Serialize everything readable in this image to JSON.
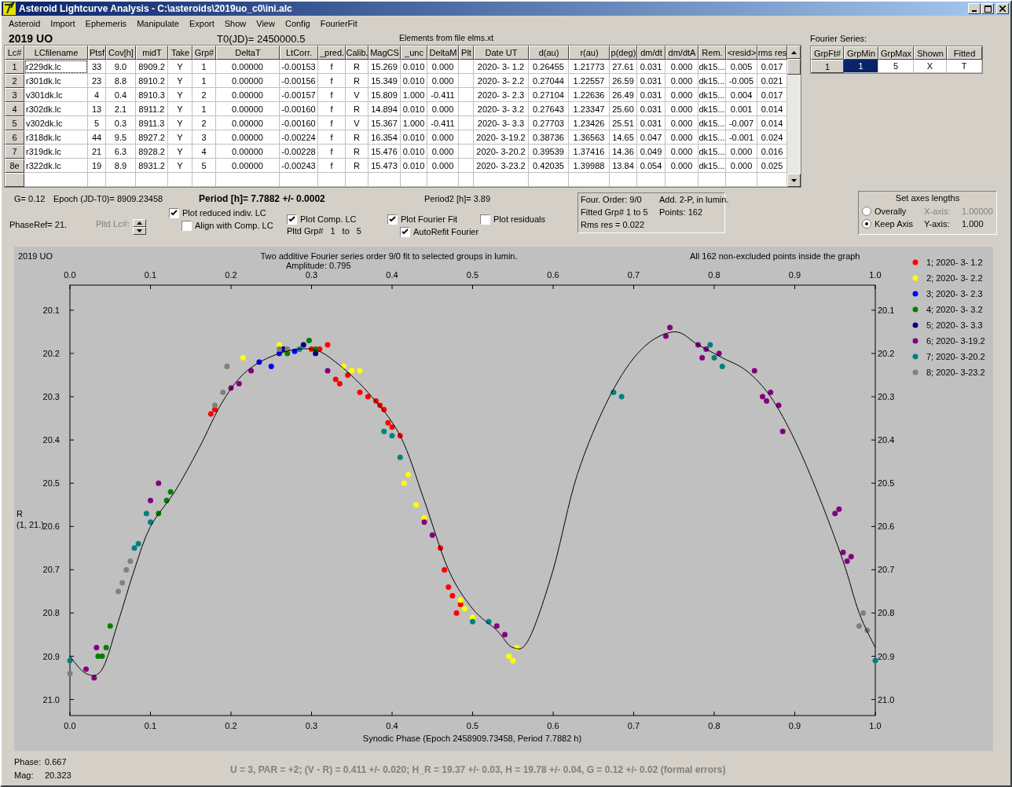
{
  "window": {
    "title": "Asteroid Lightcurve Analysis - C:\\asteroids\\2019uo_c0\\ini.alc"
  },
  "menu": [
    "Asteroid",
    "Import",
    "Ephemeris",
    "Manipulate",
    "Export",
    "Show",
    "View",
    "Config",
    "FourierFit"
  ],
  "header": {
    "object": "2019 UO",
    "t0": "T0(JD)= 2450000.5",
    "elements": "Elements from file elms.xt"
  },
  "lc_table": {
    "columns": [
      "Lc#",
      "LCfilename",
      "Ptsf",
      "Cov[h]",
      "midT",
      "Take",
      "Grp#",
      "DeltaT",
      "LtCorr.",
      "_pred.",
      "Calib.",
      "MagCS",
      "_unc",
      "DeltaM",
      "Plt",
      "Date UT",
      "d(au)",
      "r(au)",
      "p(deg)",
      "dm/dt",
      "dm/dtA",
      "Rem.",
      "<resid>",
      "rms res"
    ],
    "rows": [
      [
        "1",
        "r229dk.lc",
        "33",
        "9.0",
        "8909.2",
        "Y",
        "1",
        "0.00000",
        "-0.00153",
        "f",
        "R",
        "15.269",
        "0.010",
        "0.000",
        null,
        "2020- 3- 1.2",
        "0.26455",
        "1.21773",
        "27.61",
        "0.031",
        "0.000",
        "dk15...",
        "0.005",
        "0.017"
      ],
      [
        "2",
        "r301dk.lc",
        "23",
        "8.8",
        "8910.2",
        "Y",
        "1",
        "0.00000",
        "-0.00156",
        "f",
        "R",
        "15.349",
        "0.010",
        "0.000",
        null,
        "2020- 3- 2.2",
        "0.27044",
        "1.22557",
        "26.59",
        "0.031",
        "0.000",
        "dk15...",
        "-0.005",
        "0.021"
      ],
      [
        "3",
        "v301dk.lc",
        "4",
        "0.4",
        "8910.3",
        "Y",
        "2",
        "0.00000",
        "-0.00157",
        "f",
        "V",
        "15.809",
        "1.000",
        "-0.411",
        null,
        "2020- 3- 2.3",
        "0.27104",
        "1.22636",
        "26.49",
        "0.031",
        "0.000",
        "dk15...",
        "0.004",
        "0.017"
      ],
      [
        "4",
        "r302dk.lc",
        "13",
        "2.1",
        "8911.2",
        "Y",
        "1",
        "0.00000",
        "-0.00160",
        "f",
        "R",
        "14.894",
        "0.010",
        "0.000",
        null,
        "2020- 3- 3.2",
        "0.27643",
        "1.23347",
        "25.60",
        "0.031",
        "0.000",
        "dk15...",
        "0.001",
        "0.014"
      ],
      [
        "5",
        "v302dk.lc",
        "5",
        "0.3",
        "8911.3",
        "Y",
        "2",
        "0.00000",
        "-0.00160",
        "f",
        "V",
        "15.367",
        "1.000",
        "-0.411",
        null,
        "2020- 3- 3.3",
        "0.27703",
        "1.23426",
        "25.51",
        "0.031",
        "0.000",
        "dk15...",
        "-0.007",
        "0.014"
      ],
      [
        "6",
        "r318dk.lc",
        "44",
        "9.5",
        "8927.2",
        "Y",
        "3",
        "0.00000",
        "-0.00224",
        "f",
        "R",
        "16.354",
        "0.010",
        "0.000",
        null,
        "2020- 3-19.2",
        "0.38736",
        "1.36563",
        "14.65",
        "0.047",
        "0.000",
        "dk15...",
        "-0.001",
        "0.024"
      ],
      [
        "7",
        "r319dk.lc",
        "21",
        "6.3",
        "8928.2",
        "Y",
        "4",
        "0.00000",
        "-0.00228",
        "f",
        "R",
        "15.476",
        "0.010",
        "0.000",
        null,
        "2020- 3-20.2",
        "0.39539",
        "1.37416",
        "14.36",
        "0.049",
        "0.000",
        "dk15...",
        "0.000",
        "0.016"
      ],
      [
        "8e",
        "r322dk.lc",
        "19",
        "8.9",
        "8931.2",
        "Y",
        "5",
        "0.00000",
        "-0.00243",
        "f",
        "R",
        "15.473",
        "0.010",
        "0.000",
        null,
        "2020- 3-23.2",
        "0.42035",
        "1.39988",
        "13.84",
        "0.054",
        "0.000",
        "dk15...",
        "0.000",
        "0.025"
      ]
    ]
  },
  "fourier": {
    "label": "Fourier Series:",
    "columns": [
      "GrpFt#",
      "GrpMin",
      "GrpMax",
      "Shown",
      "Fitted"
    ],
    "rows": [
      {
        "cells": [
          {
            "text": "1",
            "selected": false
          },
          {
            "text": "1",
            "selected": true
          },
          {
            "text": "5",
            "selected": false
          },
          {
            "text": "X",
            "selected": false
          },
          {
            "text": "T",
            "selected": false
          }
        ]
      }
    ]
  },
  "info": {
    "g": "G= 0.12",
    "epoch": "Epoch (JD-T0)= 8909.23458",
    "period": "Period [h]= 7.7882 +/- 0.0002",
    "period2": "Period2 [h]= 3.89",
    "phase_ref": "PhaseRef= 21."
  },
  "pltd_lc": {
    "label": "Pltd Lc#:",
    "disabled": true
  },
  "checkboxes": [
    {
      "label": "Plot reduced indiv. LC",
      "checked": true
    },
    {
      "label": "Align with Comp. LC",
      "checked": false
    },
    {
      "label": "Plot Comp. LC",
      "checked": true
    },
    {
      "label": "Plot Fourier Fit",
      "checked": true
    },
    {
      "label": "AutoRefit Fourier",
      "checked": true
    },
    {
      "label": "Plot residuals",
      "checked": false
    }
  ],
  "pltd_grp": {
    "label": "Pltd Grp#",
    "from": "1",
    "to_label": "to",
    "to": "5"
  },
  "fit_summary": [
    "Four. Order:  9/0",
    "Add. 2-P, in lumin.",
    "Fitted Grp# 1 to 5",
    "Points: 162",
    "Rms res     = 0.022"
  ],
  "axes": {
    "title": "Set axes lengths",
    "radios": [
      {
        "label": "Overally",
        "selected": false
      },
      {
        "label": "Keep Axis",
        "selected": true
      }
    ],
    "fields": [
      {
        "label": "X-axis:",
        "value": "1.00000",
        "disabled": true
      },
      {
        "label": "Y-axis:",
        "value": "1.000",
        "disabled": false
      }
    ]
  },
  "chart": {
    "object": "2019 UO",
    "amplitude": "Amplitude: 0.795",
    "note": "All 162 non-excluded points inside the graph",
    "ylabel_sub": "(1, 21.)",
    "chart_data": {
      "type": "scatter",
      "title": "Two additive Fourier series order 9/0 fit to selected groups in lumin.",
      "xlabel": "Synodic Phase (Epoch 2458909.73458, Period 7.7882 h)",
      "ylabel": "R",
      "legend": "right",
      "xlim": [
        0,
        1
      ],
      "ylim": [
        21.037,
        20.042
      ],
      "xticks": [
        {
          "value": 0,
          "label": "0.0"
        },
        {
          "value": 0.1,
          "label": "0.1"
        },
        {
          "value": 0.2,
          "label": "0.2"
        },
        {
          "value": 0.3,
          "label": "0.3"
        },
        {
          "value": 0.4,
          "label": "0.4"
        },
        {
          "value": 0.5,
          "label": "0.5"
        },
        {
          "value": 0.6,
          "label": "0.6"
        },
        {
          "value": 0.7,
          "label": "0.7"
        },
        {
          "value": 0.8,
          "label": "0.8"
        },
        {
          "value": 0.9,
          "label": "0.9"
        },
        {
          "value": 1,
          "label": "1.0"
        }
      ],
      "yticks": [
        {
          "value": 20.1,
          "label": "20.1"
        },
        {
          "value": 20.2,
          "label": "20.2"
        },
        {
          "value": 20.3,
          "label": "20.3"
        },
        {
          "value": 20.4,
          "label": "20.4"
        },
        {
          "value": 20.5,
          "label": "20.5"
        },
        {
          "value": 20.6,
          "label": "20.6"
        },
        {
          "value": 20.7,
          "label": "20.7"
        },
        {
          "value": 20.8,
          "label": "20.8"
        },
        {
          "value": 20.9,
          "label": "20.9"
        },
        {
          "value": 21.0,
          "label": "21.0"
        }
      ],
      "series": [
        {
          "name": "1; 2020- 3- 1.2",
          "color": "#ff0000",
          "x": [
            0.175,
            0.18,
            0.3,
            0.31,
            0.32,
            0.33,
            0.335,
            0.345,
            0.36,
            0.37,
            0.38,
            0.385,
            0.39,
            0.395,
            0.4,
            0.41,
            0.46,
            0.465,
            0.47,
            0.475,
            0.48,
            0.485
          ],
          "values": [
            20.34,
            20.33,
            20.19,
            20.19,
            20.18,
            20.26,
            20.27,
            20.25,
            20.29,
            20.3,
            20.31,
            20.32,
            20.33,
            20.36,
            20.37,
            20.39,
            20.65,
            20.7,
            20.74,
            20.76,
            20.8,
            20.78
          ]
        },
        {
          "name": "2; 2020- 3- 2.2",
          "color": "#ffff00",
          "x": [
            0.215,
            0.26,
            0.34,
            0.35,
            0.36,
            0.415,
            0.42,
            0.43,
            0.44,
            0.485,
            0.49,
            0.5,
            0.545,
            0.55,
            0.555
          ],
          "values": [
            20.21,
            20.18,
            20.23,
            20.24,
            20.24,
            20.5,
            20.48,
            20.55,
            20.58,
            20.77,
            20.79,
            20.81,
            20.9,
            20.91,
            20.88
          ]
        },
        {
          "name": "3; 2020- 3- 2.3",
          "color": "#0000ff",
          "x": [
            0.235,
            0.25,
            0.26,
            0.279
          ],
          "values": [
            20.22,
            20.23,
            20.2,
            20.195
          ]
        },
        {
          "name": "4; 2020- 3- 3.2",
          "color": "#008000",
          "x": [
            0.035,
            0.04,
            0.045,
            0.05,
            0.11,
            0.12,
            0.125,
            0.27,
            0.297,
            0.305
          ],
          "values": [
            20.9,
            20.9,
            20.88,
            20.83,
            20.57,
            20.54,
            20.52,
            20.2,
            20.17,
            20.19
          ]
        },
        {
          "name": "5; 2020- 3- 3.3",
          "color": "#000080",
          "x": [
            0.265,
            0.29,
            0.305
          ],
          "values": [
            20.19,
            20.18,
            20.2
          ]
        },
        {
          "name": "6; 2020- 3-19.2",
          "color": "#800080",
          "x": [
            0.02,
            0.03,
            0.033,
            0.1,
            0.11,
            0.2,
            0.21,
            0.225,
            0.32,
            0.44,
            0.45,
            0.53,
            0.54,
            0.74,
            0.745,
            0.78,
            0.785,
            0.79,
            0.806,
            0.85,
            0.86,
            0.865,
            0.87,
            0.88,
            0.885,
            0.95,
            0.955,
            0.96,
            0.965,
            0.97
          ],
          "values": [
            20.93,
            20.95,
            20.88,
            20.54,
            20.5,
            20.28,
            20.27,
            20.24,
            20.24,
            20.59,
            20.62,
            20.83,
            20.85,
            20.16,
            20.14,
            20.18,
            20.21,
            20.19,
            20.2,
            20.24,
            20.3,
            20.31,
            20.29,
            20.32,
            20.38,
            20.57,
            20.56,
            20.66,
            20.68,
            20.67
          ]
        },
        {
          "name": "7; 2020- 3-20.2",
          "color": "#008080",
          "x": [
            0,
            0.08,
            0.085,
            0.095,
            0.1,
            0.285,
            0.39,
            0.4,
            0.41,
            0.5,
            0.52,
            0.675,
            0.685,
            0.795,
            0.8,
            0.81,
            1
          ],
          "values": [
            20.91,
            20.65,
            20.64,
            20.57,
            20.59,
            20.19,
            20.38,
            20.39,
            20.44,
            20.82,
            20.82,
            20.29,
            20.3,
            20.18,
            20.21,
            20.23,
            20.91
          ]
        },
        {
          "name": "8; 2020- 3-23.2",
          "color": "#808080",
          "x": [
            0,
            0.06,
            0.065,
            0.07,
            0.075,
            0.18,
            0.19,
            0.195,
            0.26,
            0.27,
            0.98,
            0.985,
            0.99
          ],
          "values": [
            20.94,
            20.75,
            20.73,
            20.7,
            20.68,
            20.32,
            20.29,
            20.23,
            20.19,
            20.19,
            20.83,
            20.8,
            20.84
          ]
        },
        {
          "color": "#000000",
          "type": "line",
          "x": [
            0,
            0.02,
            0.04,
            0.06,
            0.08,
            0.1,
            0.13,
            0.16,
            0.19,
            0.22,
            0.26,
            0.3,
            0.33,
            0.37,
            0.41,
            0.44,
            0.47,
            0.5,
            0.53,
            0.55,
            0.57,
            0.6,
            0.63,
            0.67,
            0.71,
            0.75,
            0.78,
            0.81,
            0.84,
            0.87,
            0.9,
            0.93,
            0.96,
            0.98,
            1
          ],
          "values": [
            20.9,
            20.94,
            20.93,
            20.82,
            20.7,
            20.6,
            20.52,
            20.42,
            20.31,
            20.24,
            20.2,
            20.19,
            20.22,
            20.29,
            20.39,
            20.54,
            20.7,
            20.79,
            20.84,
            20.88,
            20.86,
            20.7,
            20.48,
            20.3,
            20.19,
            20.15,
            20.18,
            20.21,
            20.24,
            20.3,
            20.4,
            20.53,
            20.68,
            20.8,
            20.88
          ]
        }
      ]
    }
  },
  "status": {
    "phase_label": "Phase:",
    "phase": "0.667",
    "mag_label": "Mag:",
    "mag": "20.323",
    "summary": "U = 3, PAR = +2; (V - R) = 0.411 +/- 0.020; H_R = 19.37 +/- 0.03, H = 19.78 +/- 0.04, G = 0.12 +/- 0.02 (formal errors)"
  }
}
